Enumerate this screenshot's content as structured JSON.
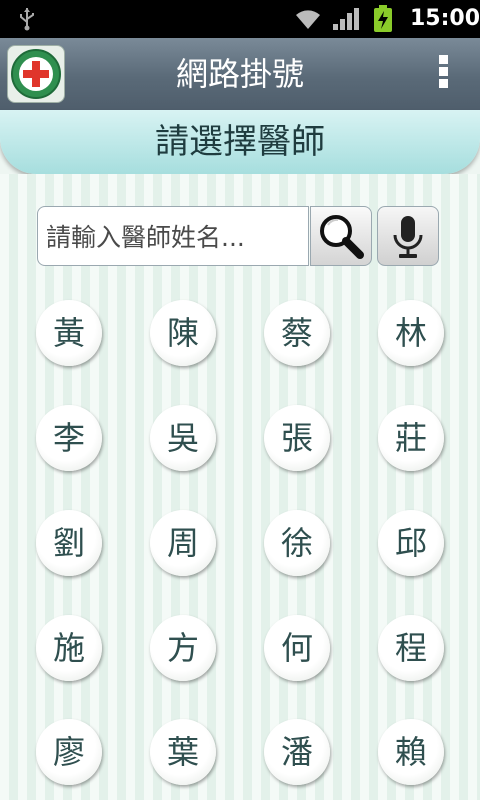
{
  "status_bar": {
    "time": "15:00",
    "icons": [
      "usb-icon",
      "wifi-icon",
      "signal-icon",
      "battery-charging-icon"
    ]
  },
  "action_bar": {
    "title": "網路掛號",
    "logo": "hospital-logo",
    "menu_icon": "overflow-menu-icon"
  },
  "section": {
    "title": "請選擇醫師"
  },
  "search": {
    "placeholder": "請輸入醫師姓名...",
    "value": "",
    "search_icon": "search-icon",
    "voice_icon": "microphone-icon"
  },
  "surnames": [
    "黃",
    "陳",
    "蔡",
    "林",
    "李",
    "吳",
    "張",
    "莊",
    "劉",
    "周",
    "徐",
    "邱",
    "施",
    "方",
    "何",
    "程",
    "廖",
    "葉",
    "潘",
    "賴"
  ],
  "colors": {
    "action_bar": "#5f6f7d",
    "section_header": "#b6e4e4",
    "surname_text": "#2f4f4f"
  }
}
